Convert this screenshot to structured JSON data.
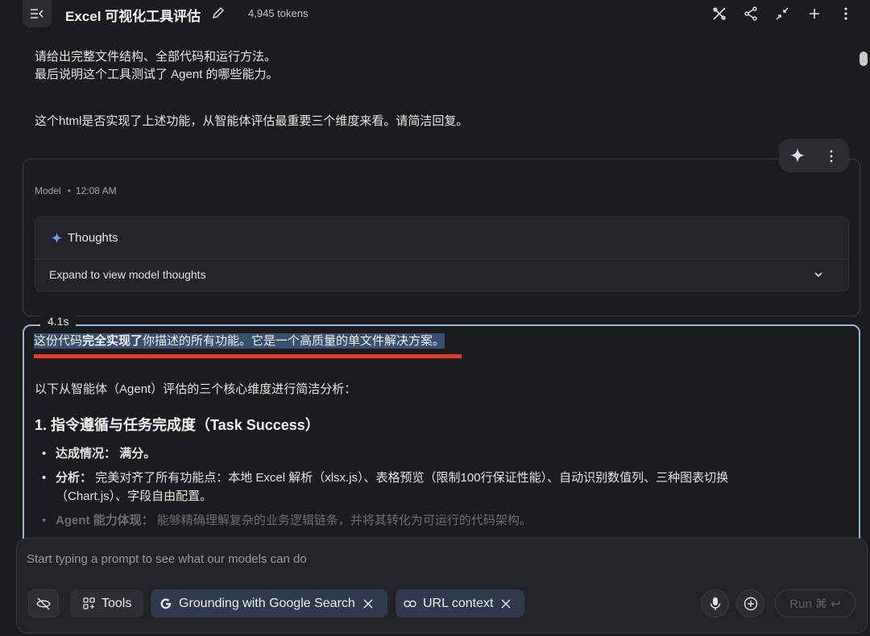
{
  "header": {
    "title": "Excel 可视化工具评估",
    "tokens": "4,945 tokens"
  },
  "user_message": {
    "line1": "请给出完整文件结构、全部代码和运行方法。",
    "line2": "最后说明这个工具测试了 Agent 的哪些能力。",
    "question": "这个html是否实现了上述功能，从智能体评估最重要三个维度来看。请简洁回复。"
  },
  "model_block": {
    "role": "Model",
    "time": "12:08 AM",
    "thoughts_label": "Thoughts",
    "thoughts_expand": "Expand to view model thoughts"
  },
  "response": {
    "elapsed": "4.1s",
    "line1_pre": "这份代码",
    "line1_bold": "完全实现了",
    "line1_post": "你描述的所有功能。它是一个高质量的单文件解决方案。",
    "intro": "以下从智能体（Agent）评估的三个核心维度进行简洁分析：",
    "heading1": "1. 指令遵循与任务完成度（Task Success）",
    "bullets": [
      {
        "label": "达成情况：",
        "text": "满分。"
      },
      {
        "label": "分析：",
        "text": "完美对齐了所有功能点：本地 Excel 解析（xlsx.js）、表格预览（限制100行保证性能）、自动识别数值列、三种图表切换（Chart.js）、字段自由配置。"
      },
      {
        "label": "Agent 能力体现：",
        "text": "能够精确理解复杂的业务逻辑链条，并将其转化为可运行的代码架构。"
      }
    ]
  },
  "prompt": {
    "placeholder": "Start typing a prompt to see what our models can do",
    "tools_label": "Tools",
    "grounding_label": "Grounding with Google Search",
    "url_context_label": "URL context",
    "run_label": "Run ⌘ ↩"
  }
}
